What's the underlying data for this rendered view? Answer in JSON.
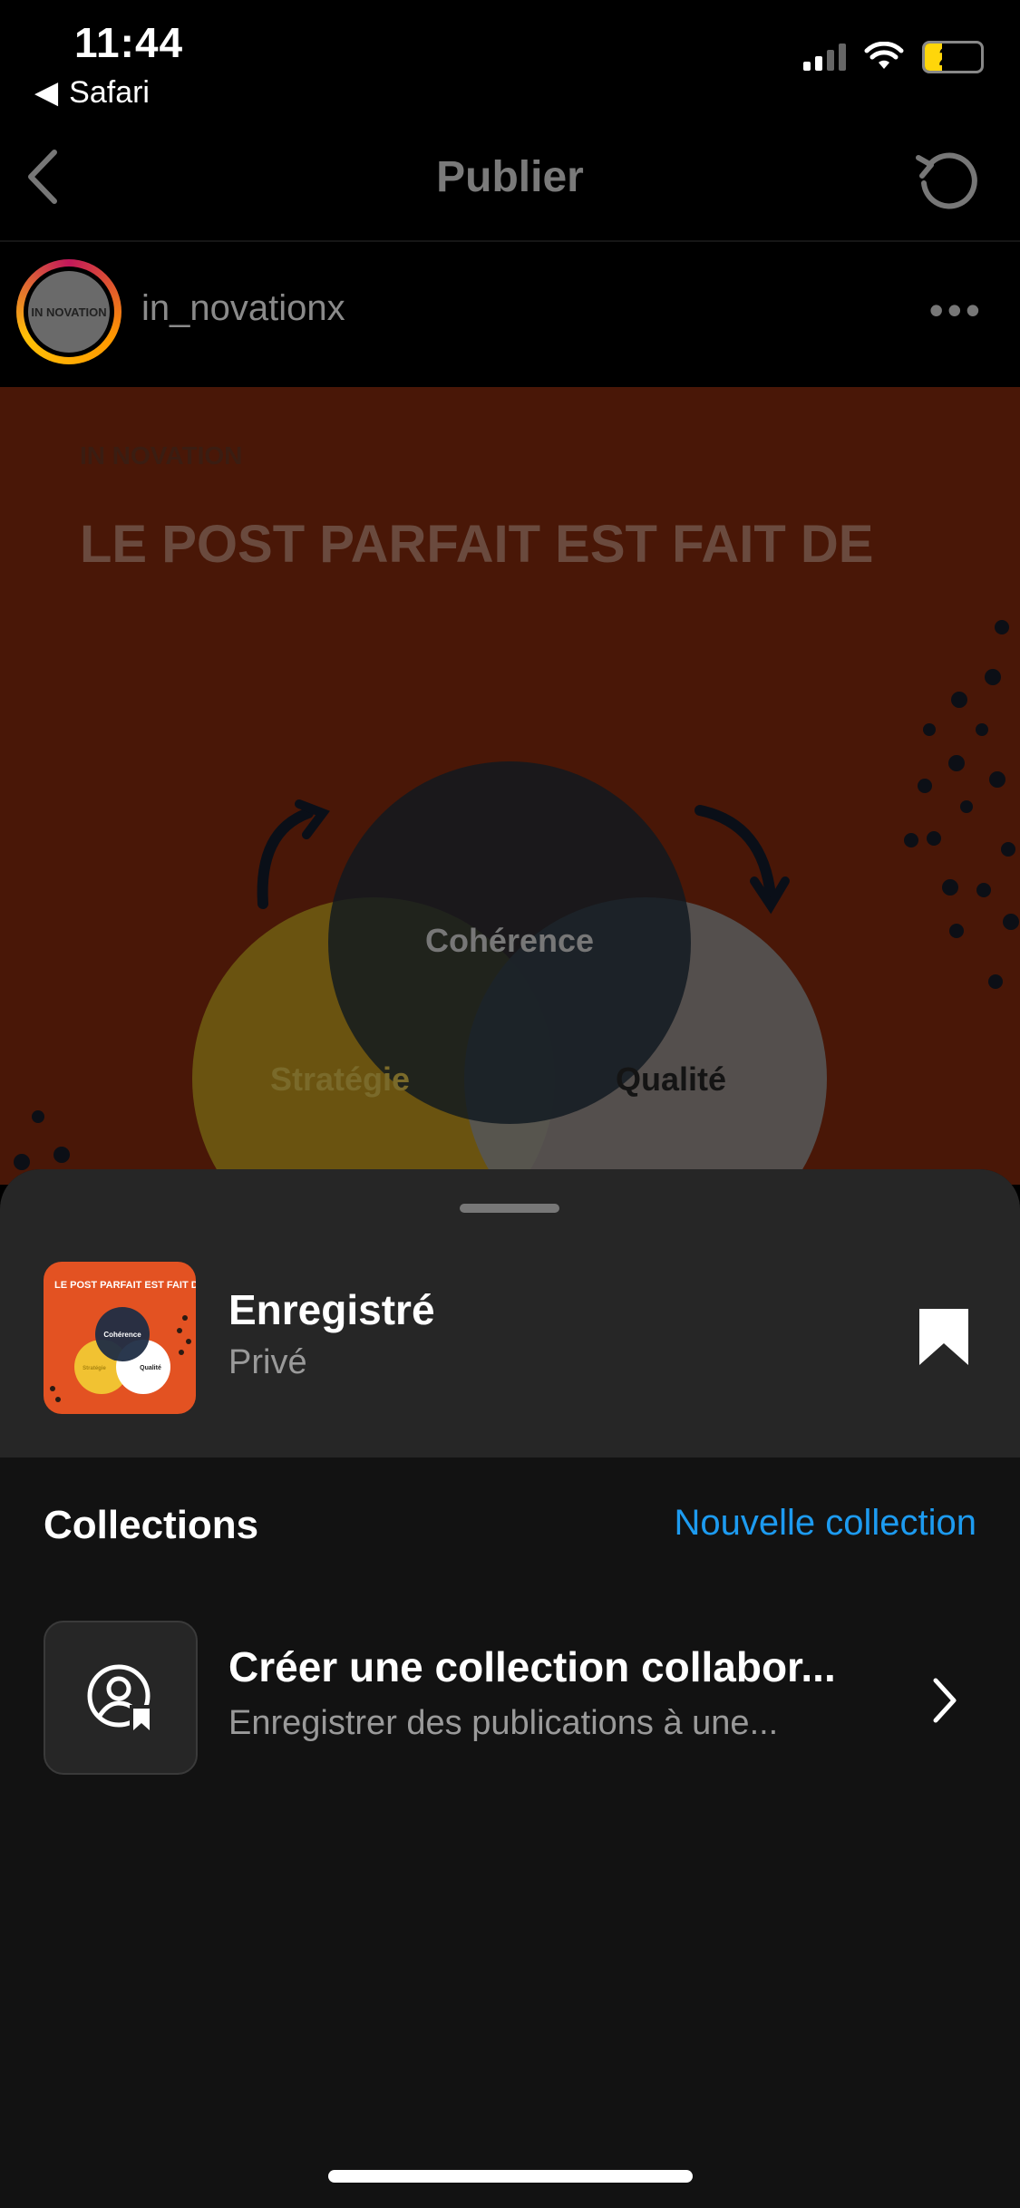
{
  "status_bar": {
    "time": "11:44",
    "back_app": "Safari",
    "battery": "26"
  },
  "nav": {
    "title": "Publier"
  },
  "post": {
    "username": "in_novationx",
    "avatar_text": "IN NOVATION",
    "image": {
      "logo": "IN NOVATION",
      "headline": "LE POST PARFAIT EST FAIT DE",
      "circles": [
        "Cohérence",
        "Stratégie",
        "Qualité"
      ]
    }
  },
  "sheet": {
    "saved_title": "Enregistré",
    "saved_subtitle": "Privé",
    "thumb_title": "LE POST PARFAIT EST FAIT DE",
    "thumb_circles": [
      "Cohérence",
      "Stratégie",
      "Qualité"
    ],
    "collections_title": "Collections",
    "new_collection": "Nouvelle collection",
    "collab_title": "Créer une collection collabor...",
    "collab_subtitle": "Enregistrer des publications à une..."
  },
  "colors": {
    "accent": "#1d9bf0",
    "post_bg": "#e35222",
    "sheet_bg": "#262626"
  }
}
